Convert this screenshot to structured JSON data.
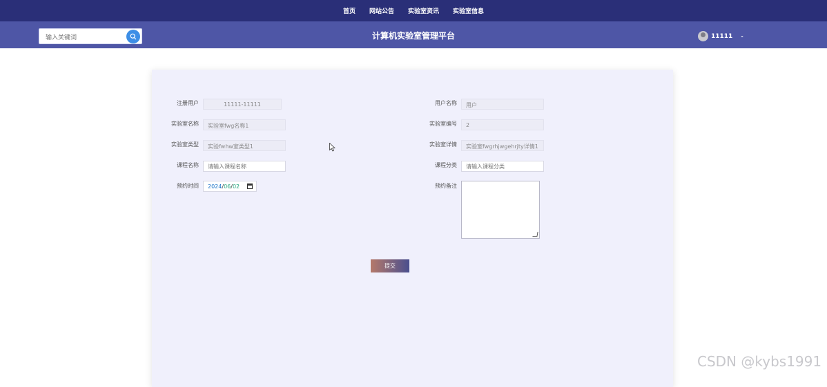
{
  "nav": {
    "items": [
      {
        "label": "首页"
      },
      {
        "label": "网站公告"
      },
      {
        "label": "实验室资讯"
      },
      {
        "label": "实验室信息"
      }
    ]
  },
  "header": {
    "search_placeholder": "输入关键词",
    "site_title": "计算机实验室管理平台",
    "username": "11111",
    "caret": "-"
  },
  "form": {
    "fields": {
      "reg_user": {
        "label": "注册用户",
        "value": "11111-11111"
      },
      "user_name": {
        "label": "用户名称",
        "value": "用户"
      },
      "lab_name": {
        "label": "实验室名称",
        "value": "实验室fwg名称1"
      },
      "lab_no": {
        "label": "实验室编号",
        "value": "2"
      },
      "lab_type": {
        "label": "实验室类型",
        "value": "实验fwhw室类型1"
      },
      "lab_detail": {
        "label": "实验室详情",
        "value": "实验室fwgrhjwgehrjty详情1"
      },
      "course_name": {
        "label": "课程名称",
        "placeholder": "请输入课程名称"
      },
      "course_category": {
        "label": "课程分类",
        "placeholder": "请输入课程分类"
      },
      "reserve_time": {
        "label": "预约时间",
        "year": "2024",
        "month": "06",
        "day": "02",
        "sep": "/"
      },
      "reserve_note": {
        "label": "预约备注"
      }
    },
    "submit_label": "提交"
  },
  "watermark": "CSDN @kybs1991",
  "colors": {
    "topnav": "#2a2f78",
    "subbar": "#4e56a6",
    "card": "#f0f0fc",
    "search_button": "#3d8ee6"
  }
}
